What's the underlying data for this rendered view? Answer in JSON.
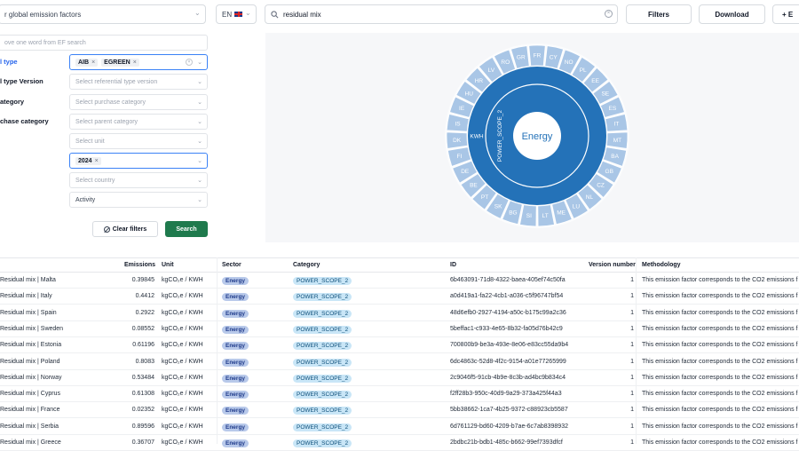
{
  "topbar": {
    "db_select": "r global emission factors",
    "lang": "EN",
    "search_value": "residual mix",
    "filters_label": "Filters",
    "download_label": "Download",
    "add_label": "+ E"
  },
  "filters": {
    "keyword_placeholder": "ove one word from EF search",
    "referential_type_label": "l type",
    "referential_chips": [
      "AIB",
      "EGREEN"
    ],
    "version_label": "l type Version",
    "version_placeholder": "Select referential type version",
    "purchase_cat_label": "ategory",
    "purchase_cat_placeholder": "Select purchase category",
    "parent_cat_label": "chase category",
    "parent_cat_placeholder": "Select parent category",
    "unit_placeholder": "Select unit",
    "year_chip": "2024",
    "country_placeholder": "Select country",
    "activity_value": "Activity",
    "clear_label": "Clear filters",
    "search_label": "Search"
  },
  "colors": {
    "primary": "#2472b8",
    "light": "#a9c6e6",
    "green": "#1f7a4d"
  },
  "chart_data": {
    "type": "sunburst",
    "center": "Energy",
    "ring1": "POWER_SCOPE_2",
    "ring2": "KWH",
    "outer_labels": [
      "FR",
      "CY",
      "NO",
      "PL",
      "EE",
      "SE",
      "ES",
      "IT",
      "MT",
      "BA",
      "GB",
      "CZ",
      "NL",
      "LU",
      "ME",
      "LT",
      "SI",
      "BG",
      "SK",
      "PT",
      "BE",
      "DE",
      "FI",
      "DK",
      "IS",
      "IE",
      "HU",
      "HR",
      "LV",
      "RO",
      "GR"
    ]
  },
  "table": {
    "headers": {
      "name": "",
      "emissions": "Emissions",
      "unit": "Unit",
      "sector": "Sector",
      "category": "Category",
      "id": "ID",
      "version": "Version number",
      "methodology": "Methodology"
    },
    "rows": [
      {
        "name": "Residual mix | Malta",
        "emissions": "0.39845",
        "unit": "kgCO₂e / KWH",
        "sector": "Energy",
        "category": "POWER_SCOPE_2",
        "id": "6b463091-71d8-4322-baea-405ef74c50fa",
        "version": "1",
        "methodology": "This emission factor corresponds to the CO2 emissions f"
      },
      {
        "name": "Residual mix | Italy",
        "emissions": "0.4412",
        "unit": "kgCO₂e / KWH",
        "sector": "Energy",
        "category": "POWER_SCOPE_2",
        "id": "a0d419a1-fa22-4cb1-a036-c5f96747bf54",
        "version": "1",
        "methodology": "This emission factor corresponds to the CO2 emissions f"
      },
      {
        "name": "Residual mix | Spain",
        "emissions": "0.2922",
        "unit": "kgCO₂e / KWH",
        "sector": "Energy",
        "category": "POWER_SCOPE_2",
        "id": "48d6efb0-2927-4194-a50c-b175c99a2c36",
        "version": "1",
        "methodology": "This emission factor corresponds to the CO2 emissions f"
      },
      {
        "name": "Residual mix | Sweden",
        "emissions": "0.08552",
        "unit": "kgCO₂e / KWH",
        "sector": "Energy",
        "category": "POWER_SCOPE_2",
        "id": "5beffac1-c933-4e65-8b32-fa05d76b42c9",
        "version": "1",
        "methodology": "This emission factor corresponds to the CO2 emissions f"
      },
      {
        "name": "Residual mix | Estonia",
        "emissions": "0.61196",
        "unit": "kgCO₂e / KWH",
        "sector": "Energy",
        "category": "POWER_SCOPE_2",
        "id": "700800b9-be3a-493e-8e06-e83cc55da9b4",
        "version": "1",
        "methodology": "This emission factor corresponds to the CO2 emissions f"
      },
      {
        "name": "Residual mix | Poland",
        "emissions": "0.8083",
        "unit": "kgCO₂e / KWH",
        "sector": "Energy",
        "category": "POWER_SCOPE_2",
        "id": "6dc4863c-52d8-4f2c-9154-a01e77265999",
        "version": "1",
        "methodology": "This emission factor corresponds to the CO2 emissions f"
      },
      {
        "name": "Residual mix | Norway",
        "emissions": "0.53484",
        "unit": "kgCO₂e / KWH",
        "sector": "Energy",
        "category": "POWER_SCOPE_2",
        "id": "2c9046f5-91cb-4b9e-8c3b-ad4bc9b834c4",
        "version": "1",
        "methodology": "This emission factor corresponds to the CO2 emissions f"
      },
      {
        "name": "Residual mix | Cyprus",
        "emissions": "0.61308",
        "unit": "kgCO₂e / KWH",
        "sector": "Energy",
        "category": "POWER_SCOPE_2",
        "id": "f2ff28b3-950c-40d9-9a29-373a425f44a3",
        "version": "1",
        "methodology": "This emission factor corresponds to the CO2 emissions f"
      },
      {
        "name": "Residual mix | France",
        "emissions": "0.02352",
        "unit": "kgCO₂e / KWH",
        "sector": "Energy",
        "category": "POWER_SCOPE_2",
        "id": "5bb38662-1ca7-4b25-9372-c88923cb5587",
        "version": "1",
        "methodology": "This emission factor corresponds to the CO2 emissions f"
      },
      {
        "name": "Residual mix | Serbia",
        "emissions": "0.89596",
        "unit": "kgCO₂e / KWH",
        "sector": "Energy",
        "category": "POWER_SCOPE_2",
        "id": "6d761129-bd60-4209-b7ae-6c7ab8398932",
        "version": "1",
        "methodology": "This emission factor corresponds to the CO2 emissions f"
      },
      {
        "name": "Residual mix | Greece",
        "emissions": "0.36707",
        "unit": "kgCO₂e / KWH",
        "sector": "Energy",
        "category": "POWER_SCOPE_2",
        "id": "2bdbc21b-bdb1-485c-b662-99ef7393dfcf",
        "version": "1",
        "methodology": "This emission factor corresponds to the CO2 emissions f"
      }
    ]
  }
}
